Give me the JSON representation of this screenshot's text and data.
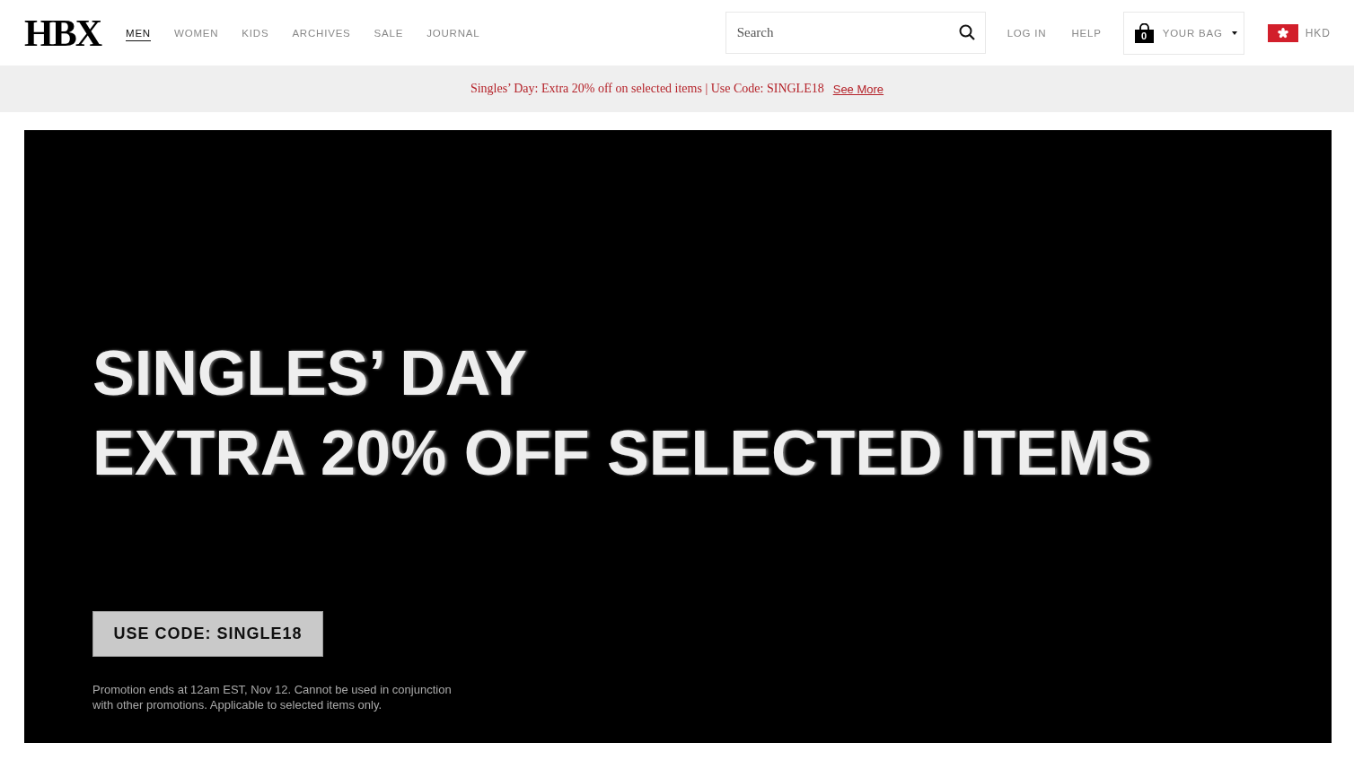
{
  "logo": "HBX",
  "nav": [
    {
      "label": "MEN",
      "selected": true
    },
    {
      "label": "WOMEN",
      "selected": false
    },
    {
      "label": "KIDS",
      "selected": false
    },
    {
      "label": "ARCHIVES",
      "selected": false
    },
    {
      "label": "SALE",
      "selected": false
    },
    {
      "label": "JOURNAL",
      "selected": false
    }
  ],
  "search": {
    "placeholder": "Search"
  },
  "account_links": [
    "LOG IN",
    "HELP"
  ],
  "bag": {
    "count": "0",
    "label": "YOUR BAG"
  },
  "currency": "HKD",
  "promo_bar": {
    "text": "Singles’ Day: Extra 20% off on selected items | Use Code: SINGLE18",
    "link": "See More"
  },
  "hero": {
    "headline": "SINGLES’ DAY",
    "subheadline": "EXTRA 20% OFF SELECTED ITEMS",
    "code_button": "USE CODE: SINGLE18",
    "fine_print": "Promotion ends at 12am EST, Nov 12. Cannot be used in conjunction with other promotions. Applicable to selected items only."
  }
}
